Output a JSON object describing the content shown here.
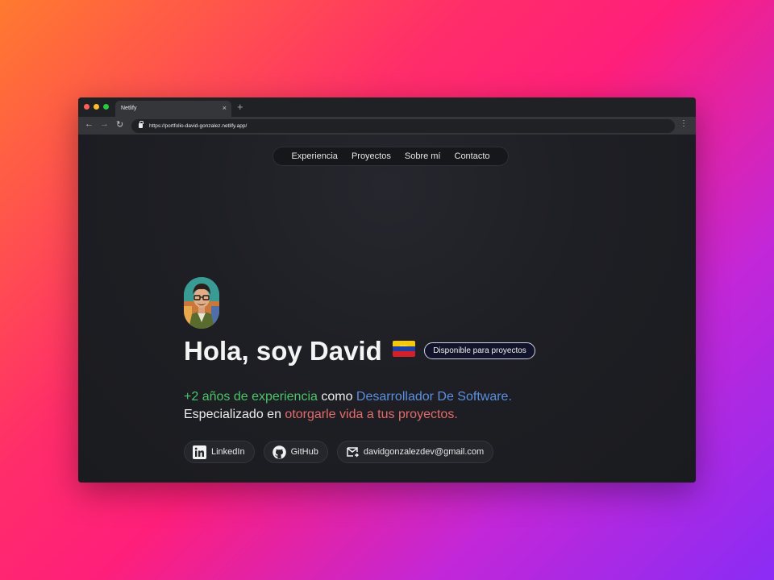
{
  "browser": {
    "tab_title": "Netlify",
    "tab_close": "×",
    "new_tab": "+",
    "url": "https://portfolio-david-gonzalez.netlify.app/",
    "back": "←",
    "forward": "→",
    "reload": "↻",
    "menu": "⋮"
  },
  "nav": {
    "items": [
      "Experiencia",
      "Proyectos",
      "Sobre mí",
      "Contacto"
    ]
  },
  "hero": {
    "title": "Hola, soy David",
    "badge": "Disponible para proyectos",
    "line1": {
      "highlight_experience": "+2 años de experiencia",
      "connector": " como ",
      "highlight_role": "Desarrollador De Software."
    },
    "line2": {
      "prefix": "Especializado en ",
      "highlight": "otorgarle vida a tus proyectos."
    }
  },
  "socials": {
    "linkedin": "LinkedIn",
    "github": "GitHub",
    "email": "davidgonzalezdev@gmail.com"
  },
  "colors": {
    "accent_green": "#4dc46a",
    "accent_blue": "#5b8fe0",
    "accent_red": "#e56a6a",
    "page_bg": "#1e1f24"
  },
  "icons": {
    "flag": "venezuela-flag-icon",
    "linkedin": "linkedin-icon",
    "github": "github-icon",
    "email": "mail-icon"
  }
}
